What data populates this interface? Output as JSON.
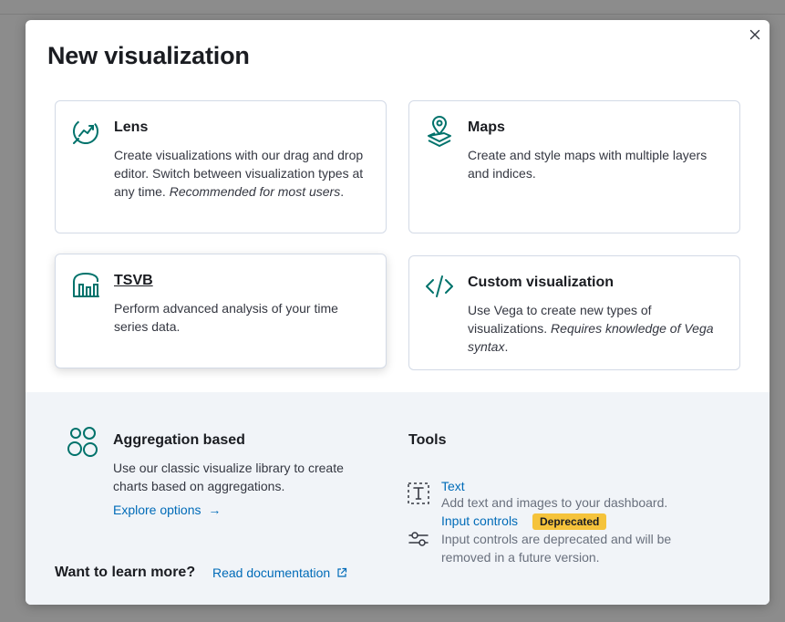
{
  "modal": {
    "title": "New visualization",
    "close_icon": "close-icon"
  },
  "cards": {
    "lens": {
      "icon": "lens-icon",
      "title": "Lens",
      "desc_plain": "Create visualizations with our drag and drop editor. Switch between visualization types at any time. ",
      "desc_italic": "Recommended for most users",
      "desc_end": "."
    },
    "maps": {
      "icon": "maps-icon",
      "title": "Maps",
      "desc_plain": "Create and style maps with multiple layers and indices."
    },
    "tsvb": {
      "icon": "tsvb-icon",
      "title": "TSVB",
      "desc_plain": "Perform advanced analysis of your time series data."
    },
    "custom": {
      "icon": "code-icon",
      "title": "Custom visualization",
      "desc_plain": "Use Vega to create new types of visualizations. ",
      "desc_italic": "Requires knowledge of Vega syntax",
      "desc_end": "."
    }
  },
  "aggregation": {
    "icon": "aggregation-icon",
    "title": "Aggregation based",
    "desc": "Use our classic visualize library to create charts based on aggregations.",
    "link": "Explore options",
    "link_arrow": "→"
  },
  "tools": {
    "title": "Tools",
    "text_tool": {
      "icon": "text-tool-icon",
      "label": "Text",
      "desc": "Add text and images to your dashboard."
    },
    "input_controls": {
      "icon": "controls-icon",
      "label": "Input controls",
      "badge": "Deprecated",
      "desc": "Input controls are deprecated and will be removed in a future version."
    }
  },
  "footer": {
    "learn": "Want to learn more?",
    "doc_link": "Read documentation",
    "doc_icon": "external-link-icon"
  },
  "colors": {
    "accent": "#006bb8",
    "icon_teal": "#00726b",
    "badge": "#f5c33b",
    "bottom_bg": "#f1f4f8",
    "overlay": "#8c8c8c"
  }
}
